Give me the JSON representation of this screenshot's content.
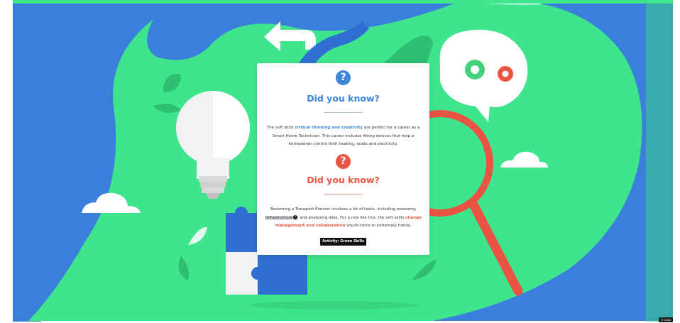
{
  "card": {
    "section1": {
      "icon": "question-mark-icon",
      "icon_glyph": "?",
      "title": "Did you know?",
      "text_before": "The soft skills ",
      "highlight": "critical thinking and creativity",
      "text_after": " are perfect for a career as a Smart Home Technician. This career includes fitting devices that help a homeowner control their heating, audio and electricity."
    },
    "section2": {
      "icon": "question-mark-icon",
      "icon_glyph": "?",
      "title": "Did you know?",
      "text_before": "Becoming a Transport Planner involves a lot of tasks, including assessing ",
      "term": "infrastructure",
      "term_info_glyph": "i",
      "text_middle": " and analysing data. For a role like this, the soft skills ",
      "highlight": "change management and collaboration",
      "text_after": " would come in extremely handy."
    },
    "button_label": "Activity: Green Skills"
  },
  "close_badge": "✕ close",
  "colors": {
    "background_green": "#3ee58c",
    "background_blue": "#3a7fdc",
    "accent_blue": "#3d86db",
    "accent_red": "#ea5343",
    "card_bg": "#ffffff",
    "button_bg": "#111111"
  },
  "illustration": {
    "elements": [
      "light-bulb",
      "brain-with-gears",
      "magnifying-glass",
      "puzzle-pieces",
      "clouds",
      "leaves",
      "arrows"
    ]
  }
}
